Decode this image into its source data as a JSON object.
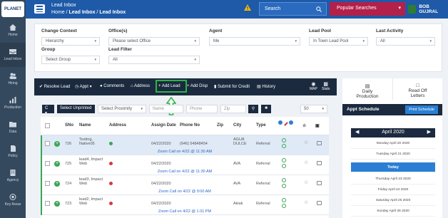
{
  "logo": "PLANET",
  "sidebar": {
    "items": [
      {
        "label": "Home",
        "icon": "home-icon"
      },
      {
        "label": "Lead Inbox",
        "icon": "inbox-icon"
      },
      {
        "label": "Hiring",
        "icon": "users-icon"
      },
      {
        "label": "Production",
        "icon": "chart-icon"
      },
      {
        "label": "Data",
        "icon": "folder-icon"
      },
      {
        "label": "Policy",
        "icon": "document-icon"
      },
      {
        "label": "Agency",
        "icon": "building-icon"
      },
      {
        "label": "Key Areas",
        "icon": "target-icon"
      }
    ]
  },
  "header": {
    "title": "Lead Inbox",
    "breadcrumb": {
      "home": "Home",
      "sep1": " / ",
      "mid": "Lead Inbox",
      "sep2": " / ",
      "last": "Lead Inbox"
    },
    "search_label": "Search",
    "popular_label": "Popular Searches",
    "user_name": "BOB GUJRAL"
  },
  "filters": {
    "change_context_label": "Change Context",
    "change_context_value": "Hierarchy",
    "offices_label": "Office(s)",
    "offices_placeholder": "Please select Office",
    "agent_label": "Agent",
    "agent_value": "Me",
    "lead_pool_label": "Lead Pool",
    "lead_pool_value": "In Town Lead Pool",
    "last_activity_label": "Last Activity",
    "last_activity_value": "All",
    "group_label": "Group",
    "group_value": "Select Group",
    "lead_filter_label": "Lead Filter",
    "lead_filter_value": "All"
  },
  "actions": {
    "resolve": "Resolve Lead",
    "appt": "Appt",
    "comments": "Comments",
    "address": "Address",
    "add_lead": "Add Lead",
    "add_disp": "Add Disp",
    "submit_credit": "Submit for Credit",
    "history": "History",
    "map": "MAP",
    "stats": "Stats"
  },
  "controls": {
    "c_label": "C",
    "select_unprinted": "Select Unprinted",
    "select_proximity": "Select Proximity",
    "name_placeholder": "Name",
    "phone_placeholder": "Phone",
    "zip_placeholder": "Zip",
    "page_size": "50"
  },
  "table": {
    "headers": {
      "sno": "SNo",
      "name": "Name",
      "address": "Address",
      "assign_date": "Assign Date",
      "phone": "Phone No",
      "zip": "Zip",
      "city": "City",
      "type": "Type"
    },
    "rows": [
      {
        "sno": "726",
        "name": "Testing, Native05",
        "assign_date": "04/22/2020",
        "phone": "(646) 54848454",
        "city": "AGUA DULCE",
        "type": "Referral",
        "status_color": "#3aa655",
        "zoom": "Zoom Call on 4/22 @ 11:30 AM"
      },
      {
        "sno": "725",
        "name": "lead4, Impact Web",
        "assign_date": "04/22/2020",
        "phone": "",
        "city": "AVA",
        "type": "Referral",
        "status_color": "#d23b3b",
        "zoom": "Zoom Call on 4/22 @ 11:30 AM"
      },
      {
        "sno": "724",
        "name": "lead3, Impact Web",
        "assign_date": "04/22/2020",
        "phone": "",
        "city": "AVA",
        "type": "Referral",
        "status_color": "#d23b3b",
        "zoom": "Zoom Call on 4/22 @ 9:00 AM"
      },
      {
        "sno": "723",
        "name": "lead2, Impact Web",
        "assign_date": "04/22/2020",
        "phone": "",
        "city": "Akiak",
        "type": "Referral",
        "status_color": "#d23b3b",
        "zoom": "Zoom Call on 4/22 @ 1:31 PM"
      }
    ]
  },
  "right_panel": {
    "tab_daily": "Daily Production",
    "tab_readoff": "Read Off Letters",
    "schedule_title": "Appt Schedule",
    "print_button": "Print Schedule",
    "calendar_month": "April 2020",
    "days": [
      "Monday April 20 2020",
      "Tuesday April 21 2020",
      "Today",
      "Thursday April 23 2020",
      "Friday April 24 2020",
      "Saturday April 25 2020",
      "Sunday April 26 2020"
    ]
  }
}
